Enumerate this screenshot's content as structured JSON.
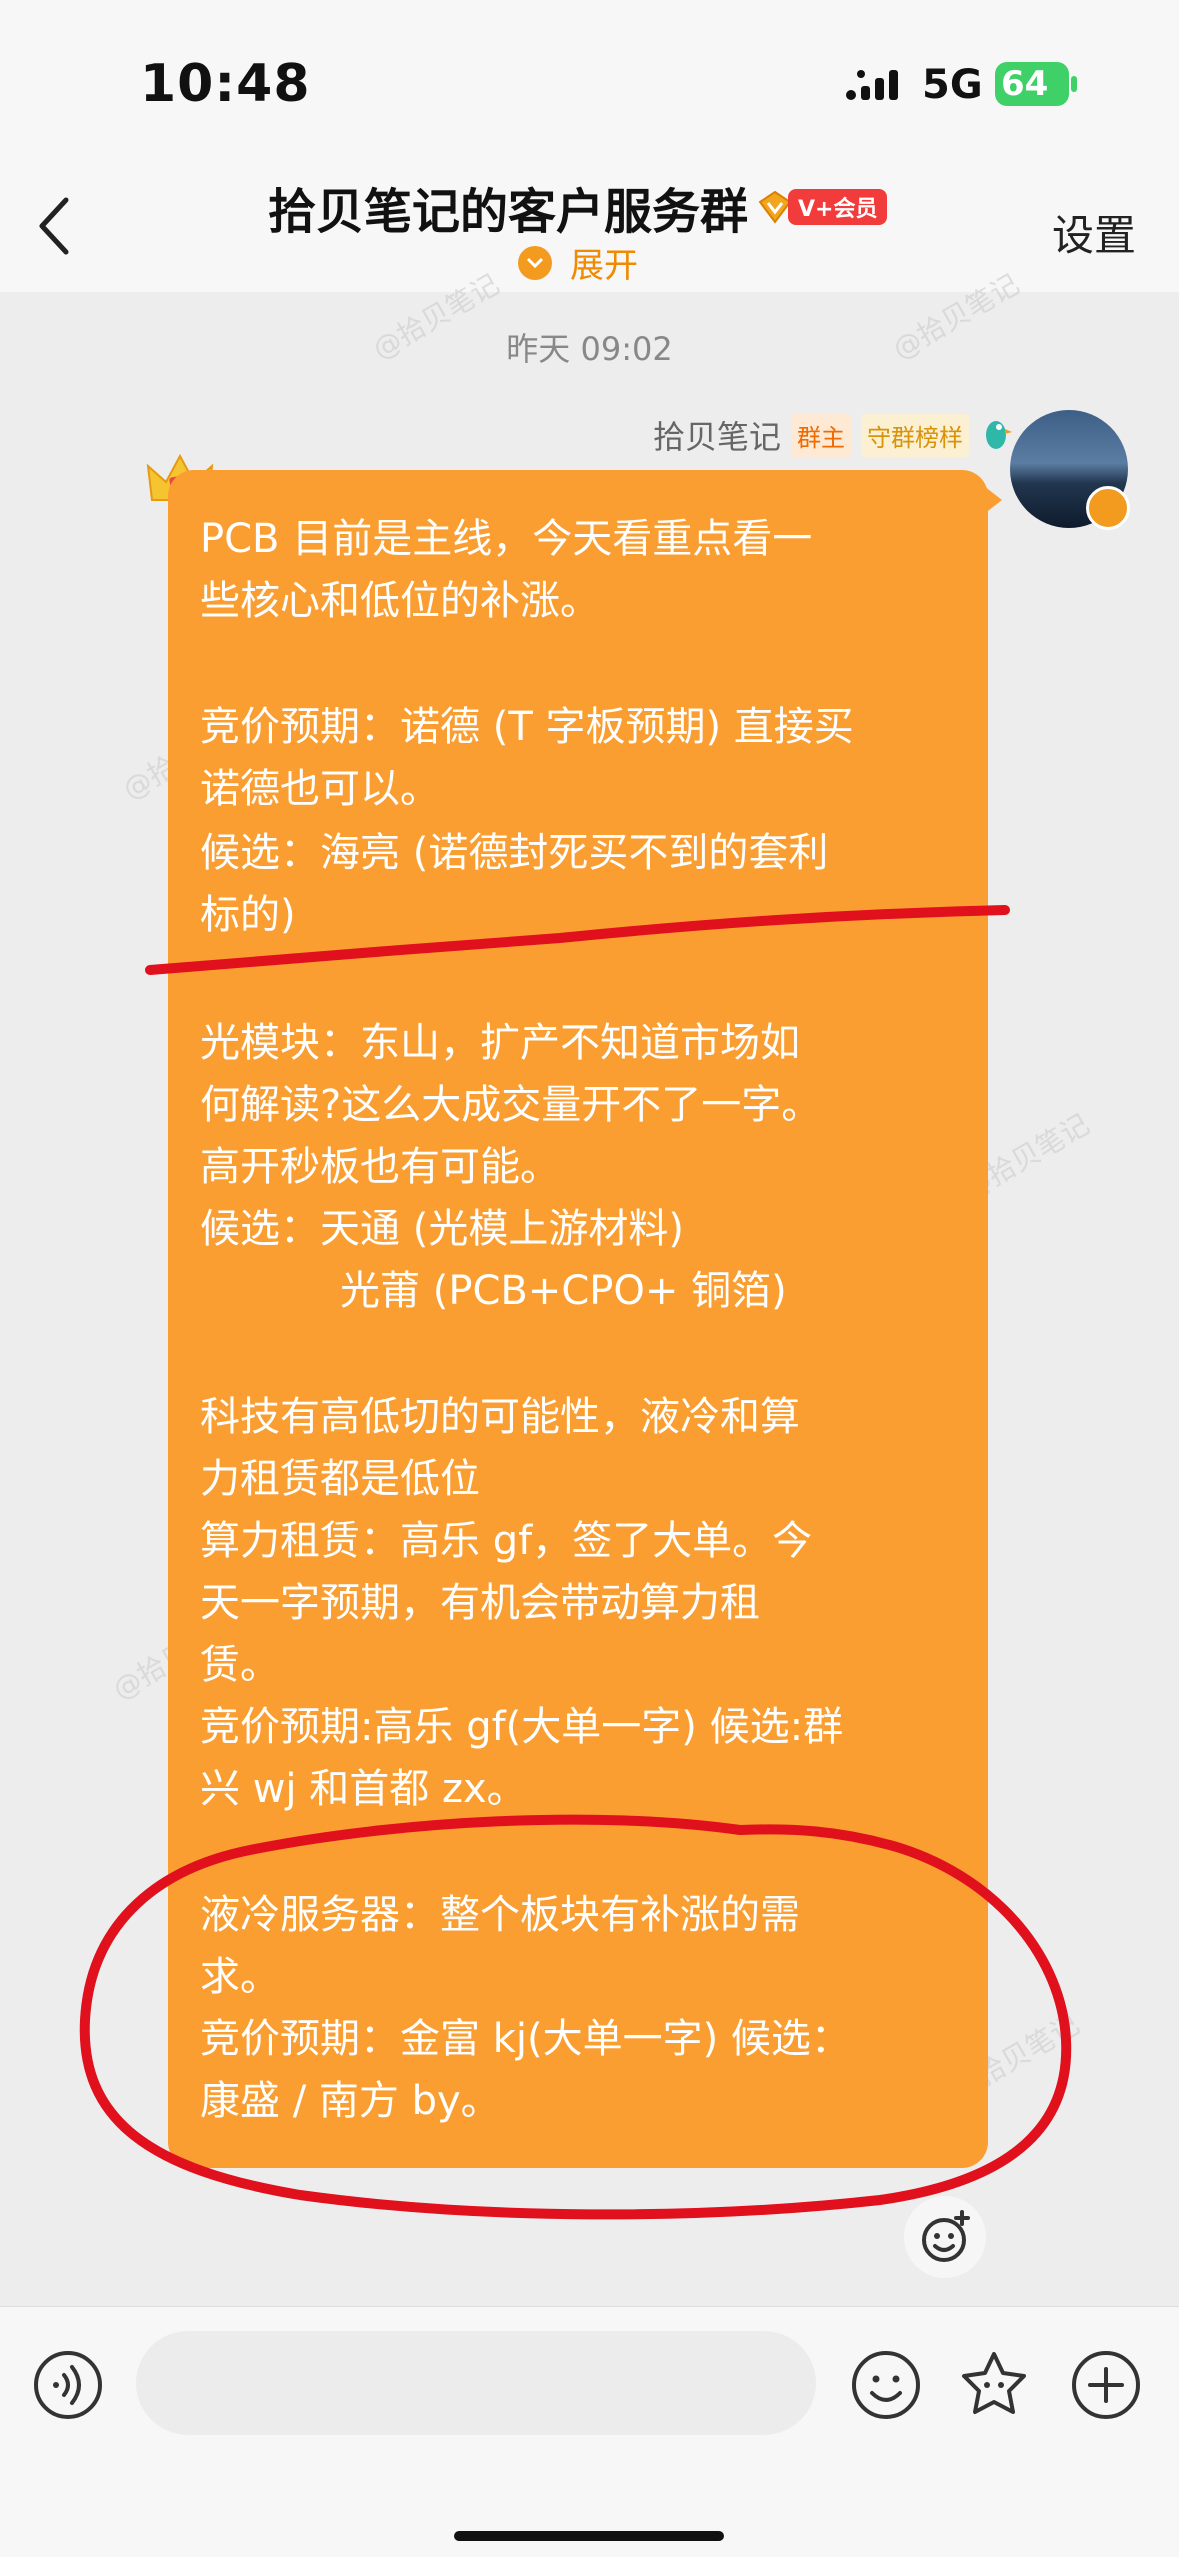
{
  "status_bar": {
    "time": "10:48",
    "network": "5G",
    "battery": "64"
  },
  "header": {
    "title": "拾贝笔记的客户服务群",
    "vip_tag": "V+会员",
    "expand_label": "展开",
    "settings_label": "设置"
  },
  "chat": {
    "timestamp": "昨天 09:02",
    "sender": {
      "name": "拾贝笔记",
      "badges": [
        "群主",
        "守群榜样"
      ]
    },
    "message_lines": [
      "PCB 目前是主线，今天看重点看一",
      "些核心和低位的补涨。",
      "竞价预期：诺德 (T 字板预期) 直接买",
      "诺德也可以。",
      "候选：海亮 (诺德封死买不到的套利",
      "标的)",
      "光模块：东山，扩产不知道市场如",
      "何解读?这么大成交量开不了一字。",
      "高开秒板也有可能。",
      "候选：天通 (光模上游材料)",
      "光莆 (PCB+CPO+ 铜箔)",
      "科技有高低切的可能性，液冷和算",
      "力租赁都是低位",
      "算力租赁：高乐 gf，签了大单。今",
      "天一字预期，有机会带动算力租",
      "赁。",
      "竞价预期:高乐 gf(大单一字) 候选:群",
      "兴 wj 和首都 zx。",
      "液冷服务器：整个板块有补涨的需",
      "求。",
      "竞价预期：金富 kj(大单一字) 候选：",
      "康盛 / 南方 by。"
    ]
  },
  "watermark": "@拾贝笔记",
  "colors": {
    "bubble": "#fa9e32",
    "accent": "#f29b1e",
    "annotation": "#e0101c"
  },
  "icons": [
    "back-arrow-icon",
    "voice-icon",
    "emoji-icon",
    "sticker-icon",
    "plus-icon",
    "crown-icon",
    "parrot-icon",
    "add-reaction-icon"
  ]
}
